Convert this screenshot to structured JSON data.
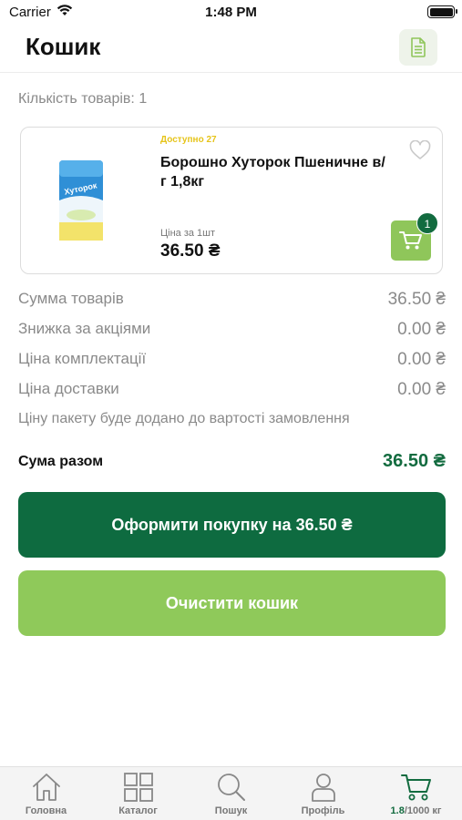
{
  "status_bar": {
    "carrier": "Carrier",
    "time": "1:48 PM"
  },
  "header": {
    "title": "Кошик",
    "doc_icon": "document-icon"
  },
  "cart": {
    "item_count_label": "Кількість товарів: 1",
    "items": [
      {
        "availability": "Доступно 27",
        "name": "Борошно Хуторок Пшеничне в/г 1,8кг",
        "price_label": "Ціна за 1шт",
        "price": "36.50 ₴",
        "quantity_badge": "1",
        "favorite_icon": "heart-outline-icon",
        "cart_icon": "shopping-cart-icon",
        "image_text": "Хуторок"
      }
    ]
  },
  "summary": {
    "rows": [
      {
        "label": "Сумма товарів",
        "value": "36.50 ₴"
      },
      {
        "label": "Знижка за акціями",
        "value": "0.00 ₴"
      },
      {
        "label": "Ціна комплектації",
        "value": "0.00 ₴"
      },
      {
        "label": "Ціна доставки",
        "value": "0.00 ₴"
      }
    ],
    "note": "Ціну пакету буде додано до вартості замовлення",
    "total_label": "Сума разом",
    "total_value": "36.50 ₴"
  },
  "actions": {
    "checkout_label": "Оформити покупку на 36.50 ₴",
    "clear_label": "Очистити кошик"
  },
  "tab_bar": {
    "items": [
      {
        "label": "Головна",
        "icon": "home-icon"
      },
      {
        "label": "Каталог",
        "icon": "grid-icon"
      },
      {
        "label": "Пошук",
        "icon": "search-icon"
      },
      {
        "label": "Профіль",
        "icon": "user-icon"
      }
    ],
    "cart_weight": "1.8",
    "cart_limit": "/1000 кг",
    "cart_icon": "cart-icon"
  },
  "colors": {
    "primary_dark_green": "#0e6b40",
    "light_green": "#8fc95a",
    "availability_yellow": "#e6c41a",
    "muted_text": "#8a8a8a"
  }
}
